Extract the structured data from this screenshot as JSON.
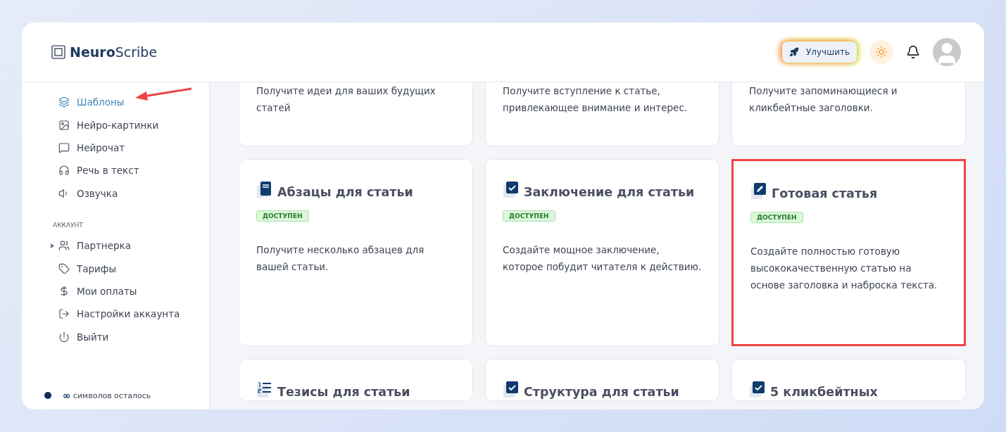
{
  "logo": {
    "bold": "Neuro",
    "light": "Scribe"
  },
  "header": {
    "upgrade_button": "Улучшить"
  },
  "sidebar": {
    "items": [
      {
        "label": "Шаблоны",
        "selected": true
      },
      {
        "label": "Нейро-картинки",
        "selected": false
      },
      {
        "label": "Нейрочат",
        "selected": false
      },
      {
        "label": "Речь в текст",
        "selected": false
      },
      {
        "label": "Озвучка",
        "selected": false
      }
    ],
    "account_heading": "АККАУНТ",
    "account_items": [
      {
        "label": "Партнерка",
        "expanded": false
      },
      {
        "label": "Тарифы"
      },
      {
        "label": "Мои оплаты"
      },
      {
        "label": "Настройки аккаунта"
      },
      {
        "label": "Выйти"
      }
    ],
    "footer": {
      "count": "∞",
      "text": "символов осталось"
    }
  },
  "cards": [
    {
      "kind": "partial",
      "description": "Получите идеи для ваших будущих статей",
      "highlighted": false
    },
    {
      "kind": "partial",
      "description": "Получите вступление к статье, привлекающее внимание и интерес.",
      "highlighted": false
    },
    {
      "kind": "partial",
      "description": "Получите запоминающиеся и кликбейтные заголовки.",
      "highlighted": false
    },
    {
      "kind": "full",
      "title": "Абзацы для статьи",
      "badge": "ДОСТУПЕН",
      "description": "Получите несколько абзацев для вашей статьи.",
      "highlighted": false
    },
    {
      "kind": "full",
      "title": "Заключение для статьи",
      "badge": "ДОСТУПЕН",
      "description": "Создайте мощное заключение, которое побудит читателя к действию.",
      "highlighted": false
    },
    {
      "kind": "full",
      "title": "Готовая статья",
      "badge": "ДОСТУПЕН",
      "description": "Создайте полностью готовую высококачественную статью на основе заголовка и наброска текста.",
      "highlighted": true
    },
    {
      "kind": "title-only",
      "title": "Тезисы для статьи",
      "highlighted": false
    },
    {
      "kind": "title-only",
      "title": "Структура для статьи",
      "highlighted": false
    },
    {
      "kind": "title-only",
      "title": "5 кликбейтных",
      "highlighted": false
    }
  ]
}
